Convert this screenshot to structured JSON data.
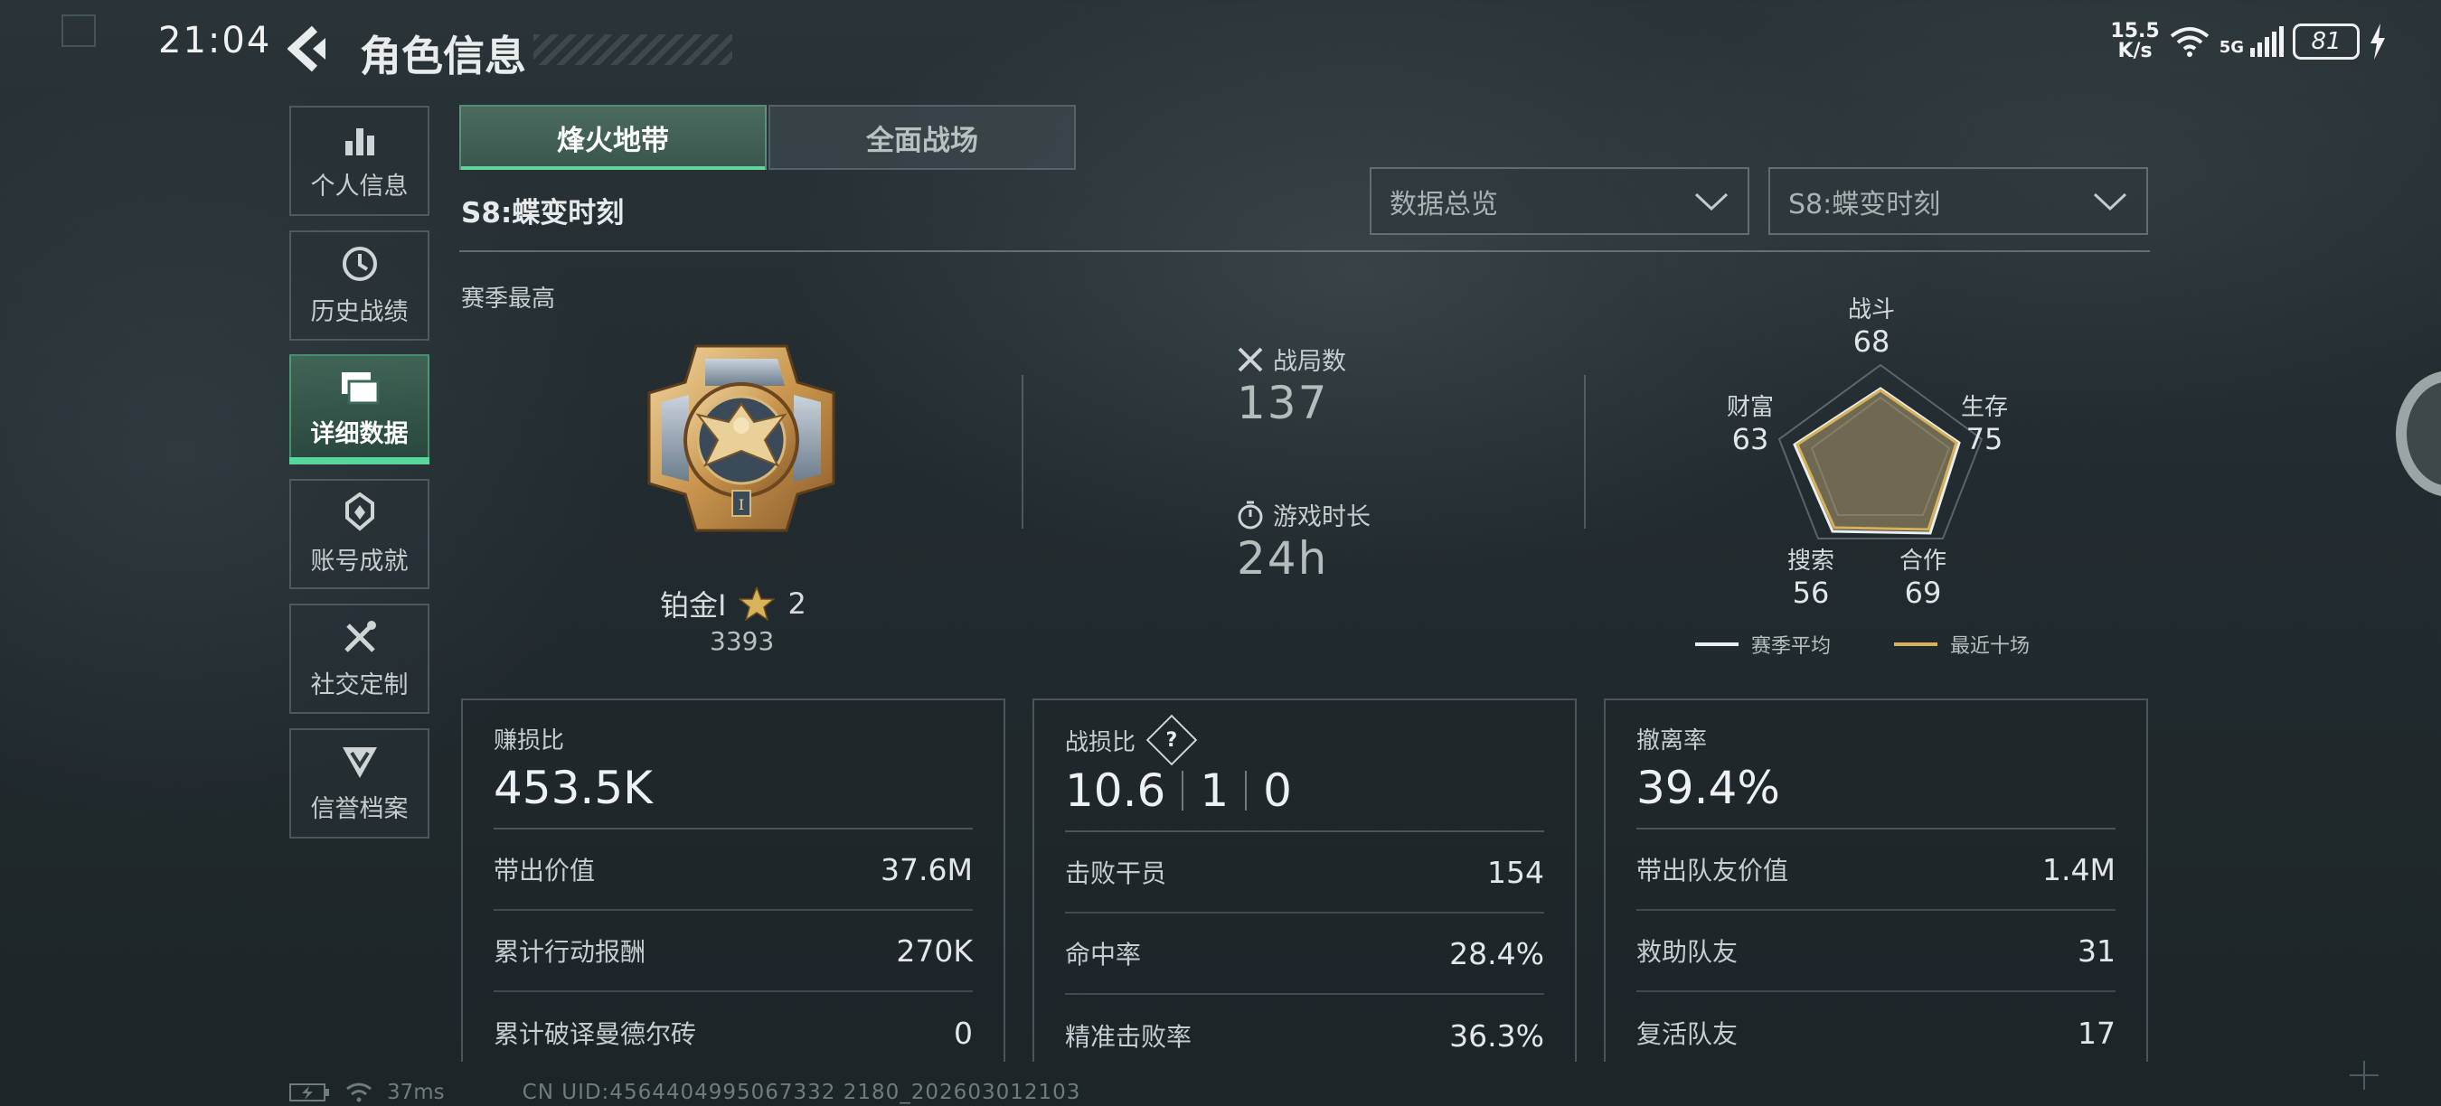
{
  "status_bar": {
    "time": "21:04",
    "net_speed_top": "15.5",
    "net_speed_bottom": "K/s",
    "network": "5G",
    "battery": "81"
  },
  "header": {
    "title": "角色信息"
  },
  "sidebar": {
    "items": [
      {
        "label": "个人信息",
        "icon": "bar-chart-icon"
      },
      {
        "label": "历史战绩",
        "icon": "history-clock-icon"
      },
      {
        "label": "详细数据",
        "icon": "folder-icon",
        "active": true
      },
      {
        "label": "账号成就",
        "icon": "achievement-icon"
      },
      {
        "label": "社交定制",
        "icon": "tools-icon"
      },
      {
        "label": "信誉档案",
        "icon": "shield-icon"
      }
    ]
  },
  "tabs": [
    {
      "label": "烽火地带",
      "active": true
    },
    {
      "label": "全面战场",
      "active": false
    }
  ],
  "season_title": "S8:蝶变时刻",
  "filters": {
    "overview": "数据总览",
    "season": "S8:蝶变时刻"
  },
  "season_best": {
    "label": "赛季最高",
    "rank": "铂金Ⅰ",
    "stars": "2",
    "score": "3393"
  },
  "stats": {
    "matches_label": "战局数",
    "matches": "137",
    "playtime_label": "游戏时长",
    "playtime": "24h"
  },
  "radar": {
    "axes": [
      {
        "label": "战斗",
        "value": "68"
      },
      {
        "label": "生存",
        "value": "75"
      },
      {
        "label": "合作",
        "value": "69"
      },
      {
        "label": "搜索",
        "value": "56"
      },
      {
        "label": "财富",
        "value": "63"
      }
    ],
    "legend": {
      "season_avg": "赛季平均",
      "recent_ten": "最近十场"
    },
    "colors": {
      "season_avg": "#e9eef0",
      "recent_ten": "#d7b15a"
    }
  },
  "cards": {
    "profit": {
      "title": "赚损比",
      "value": "453.5K",
      "rows": [
        {
          "label": "带出价值",
          "value": "37.6M"
        },
        {
          "label": "累计行动报酬",
          "value": "270K"
        },
        {
          "label": "累计破译曼德尔砖",
          "value": "0"
        }
      ]
    },
    "kd": {
      "title": "战损比",
      "help": "?",
      "kills": "10.6",
      "deaths": "1",
      "assists": "0",
      "rows": [
        {
          "label": "击败干员",
          "value": "154"
        },
        {
          "label": "命中率",
          "value": "28.4%"
        },
        {
          "label": "精准击败率",
          "value": "36.3%"
        }
      ]
    },
    "extract": {
      "title": "撤离率",
      "value": "39.4%",
      "rows": [
        {
          "label": "带出队友价值",
          "value": "1.4M"
        },
        {
          "label": "救助队友",
          "value": "31"
        },
        {
          "label": "复活队友",
          "value": "17"
        }
      ]
    }
  },
  "footer": {
    "ping": "37ms",
    "uid": "CN UID:4564404995067332 2180_202603012103"
  }
}
